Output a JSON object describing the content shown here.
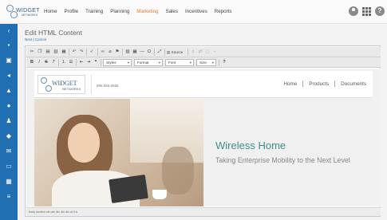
{
  "logo": {
    "text": "WIDGET",
    "subtext": "NETWORKS"
  },
  "nav": {
    "items": [
      "Home",
      "Profile",
      "Training",
      "Planning",
      "Marketing",
      "Sales",
      "Incentives",
      "Reports"
    ],
    "active": "Marketing"
  },
  "page": {
    "title": "Edit HTML Content",
    "links": "Next | Cancel"
  },
  "toolbar": {
    "source_label": "Source",
    "styles_label": "Styles",
    "format_label": "Format",
    "font_label": "Font",
    "size_label": "Size",
    "help_label": "?"
  },
  "document": {
    "logo_text": "WIDGET",
    "logo_subtext": "NETWORKS",
    "phone": "888.555.5555",
    "nav": [
      "Home",
      "Products",
      "Documents"
    ],
    "hero_title": "Wireless Home",
    "hero_subtitle": "Taking Enterprise Mobility to the Next Level"
  },
  "statusbar": {
    "path": "body  section  div  div  div  div  div  ol  li  a"
  },
  "colors": {
    "sidebar": "#1f6fb2",
    "accent_nav": "#e07a3a",
    "hero_title": "#3e8e8a"
  }
}
